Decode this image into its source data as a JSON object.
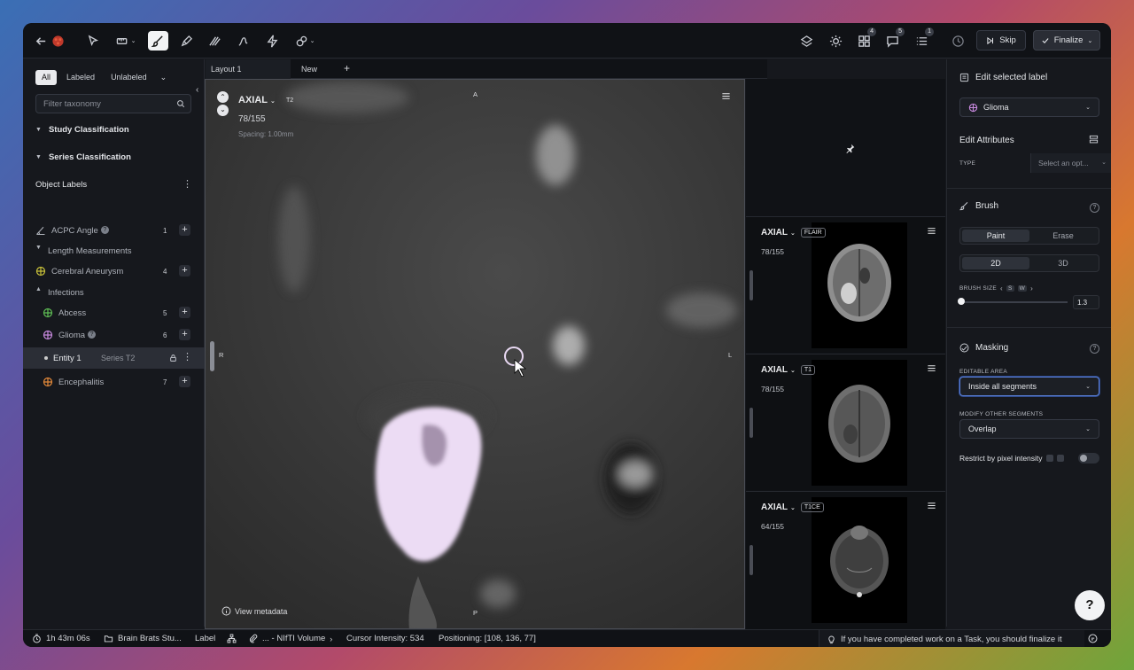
{
  "topbar": {
    "badges": {
      "layers": "4",
      "comments": "5",
      "list": "1"
    },
    "skip_label": "Skip",
    "finalize_label": "Finalize"
  },
  "sidebar": {
    "filters": [
      "All",
      "Labeled",
      "Unlabeled"
    ],
    "filter_placeholder": "Filter taxonomy",
    "study_classification": "Study Classification",
    "series_classification": "Series Classification",
    "object_labels": "Object Labels",
    "items": [
      {
        "label": "ACPC Angle",
        "count": "1",
        "color": "#9aa0aa"
      },
      {
        "label": "Length Measurements",
        "count": "",
        "color": "#9aa0aa"
      },
      {
        "label": "Cerebral Aneurysm",
        "count": "4",
        "color": "#c9c23a"
      },
      {
        "label": "Infections",
        "count": "",
        "color": "#9aa0aa"
      },
      {
        "label": "Abcess",
        "count": "5",
        "color": "#5fbf55"
      },
      {
        "label": "Glioma",
        "count": "6",
        "color": "#c98ae0"
      },
      {
        "label": "Entity 1",
        "count": "",
        "color": "#cccccc"
      },
      {
        "label": "Encephalitis",
        "count": "7",
        "color": "#e58a3a"
      }
    ],
    "entity_series": "Series T2"
  },
  "tabs": [
    "Layout 1",
    "New"
  ],
  "viewport": {
    "plane": "AXIAL",
    "sequence": "T2",
    "slice": "78/155",
    "spacing": "Spacing: 1.00mm",
    "orient": {
      "top": "A",
      "bottom": "P",
      "left": "R",
      "right": "L"
    },
    "view_metadata": "View metadata"
  },
  "minis": [
    {
      "plane": "AXIAL",
      "sequence": "FLAIR",
      "slice": "78/155"
    },
    {
      "plane": "AXIAL",
      "sequence": "T1",
      "slice": "78/155"
    },
    {
      "plane": "AXIAL",
      "sequence": "T1CE",
      "slice": "64/155"
    }
  ],
  "panel": {
    "edit_selected_label": "Edit selected label",
    "selected_label": "Glioma",
    "edit_attributes": "Edit Attributes",
    "type_label": "TYPE",
    "type_placeholder": "Select an opt...",
    "brush_title": "Brush",
    "brush_modes": [
      "Paint",
      "Erase"
    ],
    "brush_dims": [
      "2D",
      "3D"
    ],
    "brush_size_label": "BRUSH SIZE",
    "brush_size_keys": [
      "S",
      "W"
    ],
    "brush_size_value": "1.3",
    "masking_title": "Masking",
    "editable_area_label": "EDITABLE AREA",
    "editable_area_value": "Inside all segments",
    "modify_other_label": "MODIFY OTHER SEGMENTS",
    "modify_other_value": "Overlap",
    "restrict_label": "Restrict by pixel intensity"
  },
  "status": {
    "timer": "1h 43m 06s",
    "project": "Brain Brats Stu...",
    "label": "Label",
    "volume": "... - NIfTI Volume",
    "cursor_intensity": "Cursor Intensity: 534",
    "positioning": "Positioning: [108, 136, 77]",
    "hint": "If you have completed work on a Task, you should finalize it"
  },
  "help_fab": "?"
}
